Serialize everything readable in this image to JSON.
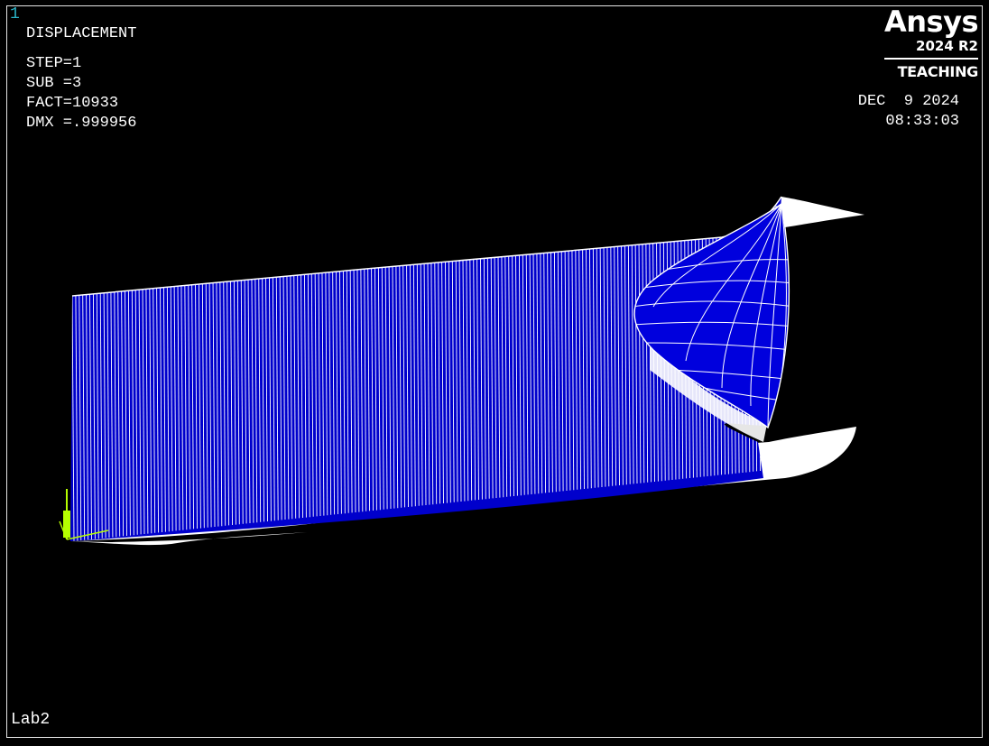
{
  "viewport": {
    "window_number": "1",
    "result_title": "DISPLACEMENT",
    "step": "STEP=1",
    "substep": "SUB =3",
    "factor": "FACT=10933",
    "dmx": "DMX =.999956",
    "date": "DEC  9 2024",
    "time": "08:33:03",
    "jobname": "Lab2"
  },
  "logo": {
    "name": "Ansys",
    "version": "2024 R2",
    "edition": "TEACHING"
  },
  "colors": {
    "background": "#000000",
    "mesh_fill": "#0000cc",
    "mesh_lines": "#ffffff",
    "window_number": "#2ab3c6",
    "triad": "#b6ff00"
  },
  "icons": {
    "triad": "global-coordinate-triad-icon"
  }
}
